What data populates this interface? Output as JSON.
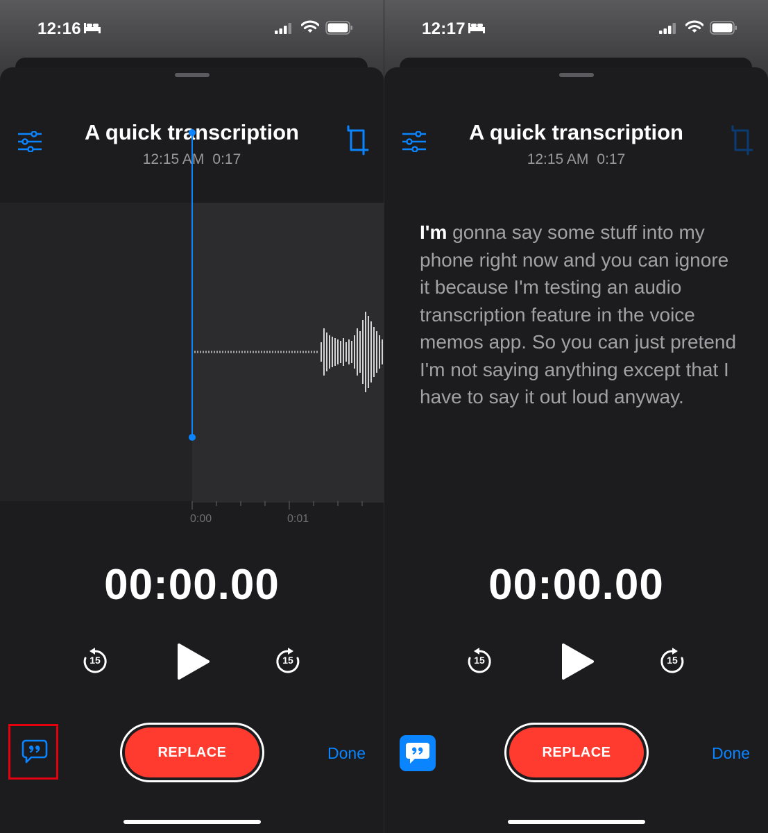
{
  "colors": {
    "accent": "#0a84ff",
    "record": "#ff3b30",
    "highlight_box": "#e3000f"
  },
  "screens": [
    {
      "status": {
        "time": "12:16",
        "icons": [
          "bed-icon",
          "cellular-signal-icon",
          "wifi-icon",
          "battery-icon"
        ]
      },
      "recording": {
        "title": "A quick transcription",
        "date": "12:15 AM",
        "duration": "0:17"
      },
      "timeline_labels": [
        "0:00",
        "0:01"
      ],
      "timer": "00:00.00",
      "controls": {
        "skip_back": "15",
        "skip_forward": "15",
        "replace": "REPLACE",
        "done": "Done"
      }
    },
    {
      "status": {
        "time": "12:17",
        "icons": [
          "bed-icon",
          "cellular-signal-icon",
          "wifi-icon",
          "battery-icon"
        ]
      },
      "recording": {
        "title": "A quick transcription",
        "date": "12:15 AM",
        "duration": "0:17"
      },
      "transcript": {
        "highlighted": "I'm",
        "rest": " gonna say some stuff into my phone right now and you can ignore it because I'm testing an audio transcription feature in the voice memos app. So you can just pretend I'm not saying anything except that I have to say it out loud anyway."
      },
      "timer": "00:00.00",
      "controls": {
        "skip_back": "15",
        "skip_forward": "15",
        "replace": "REPLACE",
        "done": "Done"
      }
    }
  ]
}
